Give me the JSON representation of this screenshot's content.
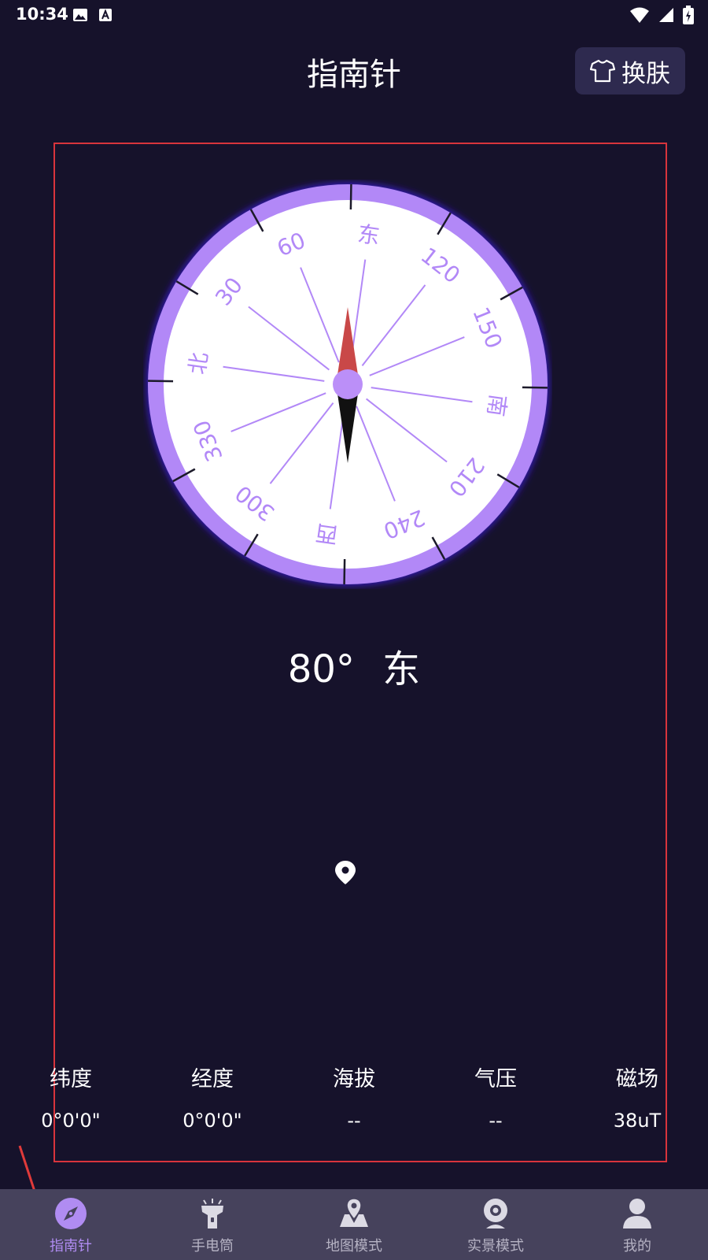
{
  "status_bar": {
    "time": "10:34"
  },
  "header": {
    "title": "指南针",
    "skin_button_label": "换肤"
  },
  "compass": {
    "dial_labels": [
      "北",
      "30",
      "60",
      "东",
      "120",
      "150",
      "南",
      "210",
      "240",
      "西",
      "300",
      "330"
    ],
    "heading_degrees": 80,
    "colors": {
      "ring": "#b288f7",
      "glow": "#3a1fd6",
      "needle_north": "#c94848",
      "needle_south": "#111111",
      "hub": "#bb8ff8"
    }
  },
  "heading_display": {
    "value": "80°",
    "direction": "东"
  },
  "info": [
    {
      "label": "纬度",
      "value": "0°0'0\""
    },
    {
      "label": "经度",
      "value": "0°0'0\""
    },
    {
      "label": "海拔",
      "value": "--"
    },
    {
      "label": "气压",
      "value": "--"
    },
    {
      "label": "磁场",
      "value": "38uT"
    }
  ],
  "nav": [
    {
      "label": "指南针",
      "icon": "compass-icon",
      "active": true
    },
    {
      "label": "手电筒",
      "icon": "flashlight-icon",
      "active": false
    },
    {
      "label": "地图模式",
      "icon": "map-icon",
      "active": false
    },
    {
      "label": "实景模式",
      "icon": "camera-icon",
      "active": false
    },
    {
      "label": "我的",
      "icon": "user-icon",
      "active": false
    }
  ],
  "colors": {
    "background": "#16122b",
    "accent": "#b08cf2",
    "nav_background": "#46425c",
    "highlight_frame": "#d8343c"
  }
}
